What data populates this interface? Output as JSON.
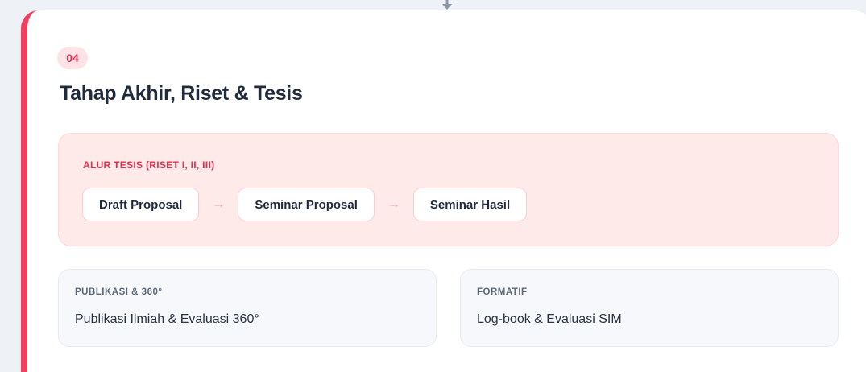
{
  "step": {
    "number": "04",
    "title": "Tahap Akhir, Riset & Tesis"
  },
  "thesis_flow": {
    "label": "ALUR TESIS (RISET I, II, III)",
    "steps": [
      "Draft Proposal",
      "Seminar Proposal",
      "Seminar Hasil"
    ],
    "arrow": "→"
  },
  "info_boxes": [
    {
      "label": "PUBLIKASI & 360°",
      "value": "Publikasi Ilmiah & Evaluasi 360°"
    },
    {
      "label": "FORMATIF",
      "value": "Log-book & Evaluasi SIM"
    }
  ],
  "colors": {
    "accent": "#f0405f",
    "badge_bg": "#fde3e6",
    "panel_bg": "#ffeaea",
    "connector": "#8a96a8"
  },
  "icons": {
    "connector": "arrow-down-icon"
  }
}
